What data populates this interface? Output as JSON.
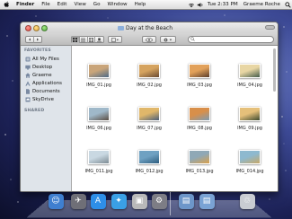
{
  "menubar": {
    "app_name": "Finder",
    "menus": [
      "File",
      "Edit",
      "View",
      "Go",
      "Window",
      "Help"
    ],
    "clock": "Tue 2:33 PM",
    "user": "Graeme Roche"
  },
  "window": {
    "title": "Day at the Beach",
    "search": {
      "placeholder": ""
    }
  },
  "sidebar": {
    "favorites_heading": "FAVORITES",
    "items": [
      {
        "label": "All My Files",
        "icon": "all-files-icon"
      },
      {
        "label": "Desktop",
        "icon": "desktop-icon"
      },
      {
        "label": "Graeme",
        "icon": "home-icon"
      },
      {
        "label": "Applications",
        "icon": "applications-icon"
      },
      {
        "label": "Documents",
        "icon": "documents-icon"
      },
      {
        "label": "SkyDrive",
        "icon": "skydrive-icon"
      }
    ],
    "shared_heading": "SHARED"
  },
  "files": [
    {
      "name": "IMG_01.jpg",
      "colors": [
        "#c9a57a",
        "#4e6a86"
      ]
    },
    {
      "name": "IMG_02.jpg",
      "colors": [
        "#d5a35f",
        "#6a4a31"
      ]
    },
    {
      "name": "IMG_03.jpg",
      "colors": [
        "#e2a15a",
        "#5a3d2a"
      ]
    },
    {
      "name": "IMG_04.jpg",
      "colors": [
        "#e8d6a4",
        "#445c4a"
      ]
    },
    {
      "name": "IMG_06.jpg",
      "colors": [
        "#9fb8c9",
        "#5a4e43"
      ]
    },
    {
      "name": "IMG_07.jpg",
      "colors": [
        "#e0b76a",
        "#4b5f7a"
      ]
    },
    {
      "name": "IMG_08.jpg",
      "colors": [
        "#d88f4a",
        "#7e9bb2"
      ]
    },
    {
      "name": "IMG_09.jpg",
      "colors": [
        "#e5c07a",
        "#3d4a2f"
      ]
    },
    {
      "name": "IMG_011.jpg",
      "colors": [
        "#c9d8e2",
        "#7d8b93"
      ]
    },
    {
      "name": "IMG_012.jpg",
      "colors": [
        "#6fa1c2",
        "#2e5d7e"
      ]
    },
    {
      "name": "IMG_013.jpg",
      "colors": [
        "#8fa8b6",
        "#d9a04b"
      ]
    },
    {
      "name": "IMG_014.jpg",
      "colors": [
        "#8eb9cf",
        "#c7a868"
      ]
    }
  ],
  "dock": [
    {
      "name": "finder-dock-icon",
      "symbol": "☺",
      "bg": "#3f7fd0"
    },
    {
      "name": "launchpad-dock-icon",
      "symbol": "✈",
      "bg": "#6f6f77"
    },
    {
      "name": "app-store-dock-icon",
      "symbol": "A",
      "bg": "#2e8fe8"
    },
    {
      "name": "safari-dock-icon",
      "symbol": "✦",
      "bg": "#3aa0e6"
    },
    {
      "name": "preview-dock-icon",
      "symbol": "▣",
      "bg": "#b9b9b9"
    },
    {
      "name": "system-preferences-dock-icon",
      "symbol": "⚙",
      "bg": "#7d7d85"
    },
    {
      "name": "applications-stack-dock-icon",
      "symbol": "▤",
      "bg": "#6d96c9"
    },
    {
      "name": "documents-stack-dock-icon",
      "symbol": "▤",
      "bg": "#7aa3d4"
    },
    {
      "name": "trash-dock-icon",
      "symbol": "♲",
      "bg": "#c9ccd2"
    }
  ]
}
